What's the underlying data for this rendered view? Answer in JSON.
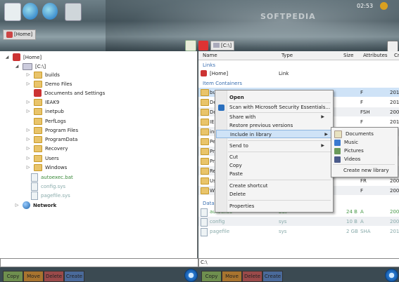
{
  "desktop": {
    "watermark": "SOFTPEDIA",
    "clock": "02:53",
    "home_tab": "[Home]",
    "right_crumb": "[C:\\]"
  },
  "tree": {
    "home": "[Home]",
    "drive": "[C:\\]",
    "items": [
      "builds",
      "Demo Files",
      "Documents and Settings",
      "IEAK9",
      "inetpub",
      "PerfLogs",
      "Program Files",
      "ProgramData",
      "Recovery",
      "Users",
      "Windows"
    ],
    "files": [
      "autoexec.bat",
      "config.sys",
      "pagefile.sys"
    ],
    "network": "Network"
  },
  "list": {
    "columns": {
      "name": "Name",
      "type": "Type",
      "size": "Size",
      "attributes": "Attributes",
      "created": "Cr"
    },
    "links_group": "Links",
    "home_row": {
      "name": "[Home]",
      "type": "Link"
    },
    "containers_group": "Item Containers",
    "folder_rows": [
      {
        "name": "bu",
        "attr": "F",
        "created": "201"
      },
      {
        "name": "De",
        "attr": "F",
        "created": "201"
      },
      {
        "name": "Do",
        "attr": "FSH",
        "created": "200"
      },
      {
        "name": "IE",
        "attr": "F",
        "created": "201"
      },
      {
        "name": "ine",
        "attr": "",
        "created": ""
      },
      {
        "name": "Pe",
        "attr": "",
        "created": ""
      },
      {
        "name": "Pr",
        "attr": "",
        "created": ""
      },
      {
        "name": "Pr",
        "attr": "",
        "created": ""
      },
      {
        "name": "Re",
        "attr": "",
        "created": ""
      },
      {
        "name": "Us",
        "attr": "FR",
        "created": "200"
      },
      {
        "name": "Wi",
        "attr": "F",
        "created": "200"
      }
    ],
    "data_group": "Data C",
    "file_rows": [
      {
        "name": "autoexec",
        "type": "bat",
        "size": "24 B",
        "attr": "A",
        "created": "200"
      },
      {
        "name": "config",
        "type": "sys",
        "size": "10 B",
        "attr": "A",
        "created": "200"
      },
      {
        "name": "pagefile",
        "type": "sys",
        "size": "2 GB",
        "attr": "SHA",
        "created": "201"
      }
    ]
  },
  "context_menu": {
    "open": "Open",
    "scan": "Scan with Microsoft Security Essentials...",
    "share": "Share with",
    "restore": "Restore previous versions",
    "include": "Include in library",
    "send": "Send to",
    "cut": "Cut",
    "copy": "Copy",
    "paste": "Paste",
    "shortcut": "Create shortcut",
    "delete": "Delete",
    "properties": "Properties"
  },
  "submenu": {
    "documents": "Documents",
    "music": "Music",
    "pictures": "Pictures",
    "videos": "Videos",
    "new_library": "Create new library"
  },
  "bottom": {
    "right_path": "C:\\",
    "copy": "Copy",
    "move": "Move",
    "delete": "Delete",
    "create": "Create"
  }
}
